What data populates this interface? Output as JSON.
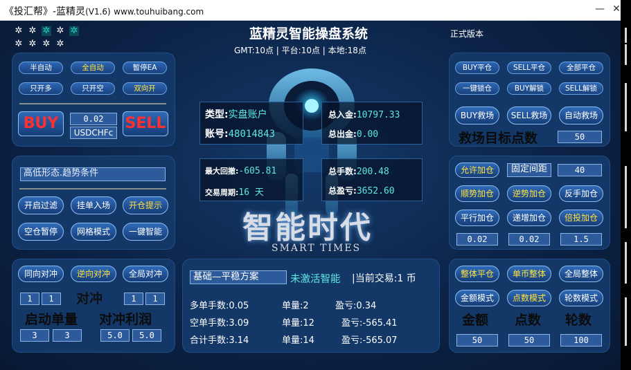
{
  "window": {
    "title": "《投汇帮》-蓝精灵",
    "version": "(V1.6)",
    "url": "www.touhuibang.com",
    "minimize": "—",
    "close": "✕"
  },
  "header": {
    "title": "蓝精灵智能操盘系统",
    "times": "GMT:10点 | 平台:10点 | 本地:18点",
    "edition": "正式版本"
  },
  "stars": [
    "✲",
    "✲",
    "✲",
    "✲",
    "✲",
    "✲",
    "✲",
    "✲",
    "✲"
  ],
  "left_top": {
    "row1": [
      "半自动",
      "全自动",
      "暂停EA"
    ],
    "row2": [
      "只开多",
      "只开空",
      "双向开"
    ],
    "buy": "BUY",
    "sell": "SELL",
    "lot": "0.02",
    "symbol": "USDCHFc"
  },
  "left_mid": {
    "trend": "高低形态.趋势条件",
    "row1": [
      "开启过滤",
      "挂单入场",
      "开仓提示"
    ],
    "row2": [
      "空仓暂停",
      "网格模式",
      "一键智能"
    ]
  },
  "left_bot": {
    "row1": [
      "同向对冲",
      "逆向对冲",
      "全局对冲"
    ],
    "hedge_label": "对冲",
    "f_left": [
      "1",
      "1"
    ],
    "f_right": [
      "1",
      "1"
    ],
    "start_lot_label": "启动单量",
    "hedge_profit_label": "对冲利润",
    "start_lots": [
      "3",
      "3"
    ],
    "hedge_profits": [
      "5.0",
      "5.0"
    ]
  },
  "center": {
    "type_label": "类型:",
    "type_value": "实盘账户",
    "account_label": "账号:",
    "account_value": "48014843",
    "deposit_label": "总入金:",
    "deposit_value": "10797.33",
    "withdraw_label": "总出金:",
    "withdraw_value": "0.00",
    "drawdown_label": "最大回撤:",
    "drawdown_value": "-605.81",
    "period_label": "交易周期:",
    "period_value": "16 天",
    "lots_label": "总手数:",
    "lots_value": "200.48",
    "profit_label": "总盈亏:",
    "profit_value": "3652.60",
    "logo_main": "智能时代",
    "logo_sub": "SMART TIMES"
  },
  "center_bot": {
    "plan": "基础—平稳方案",
    "status": "未激活智能",
    "current": "|当前交易:1 币",
    "rows": [
      [
        "多单手数:0.05",
        "单量:2",
        "盈亏:0.34"
      ],
      [
        "空单手数:3.09",
        "单量:12",
        "盈亏:-565.41"
      ],
      [
        "合计手数:3.14",
        "单量:14",
        "盈亏:-565.07"
      ]
    ]
  },
  "right_top": {
    "row1": [
      "BUY平仓",
      "SELL平仓",
      "全部平仓"
    ],
    "row2": [
      "一键锁仓",
      "BUY解锁",
      "SELL解锁"
    ],
    "row3": [
      "BUY救场",
      "SELL救场",
      "自动救场"
    ],
    "rescue_label": "救场目标点数",
    "rescue_value": "50"
  },
  "right_mid": {
    "allow": "允许加仓",
    "fixed_label": "固定间距",
    "fixed_value": "40",
    "row2": [
      "顺势加仓",
      "逆势加仓",
      "反手加仓"
    ],
    "row3": [
      "平行加仓",
      "递增加仓",
      "倍投加仓"
    ],
    "values": [
      "0.02",
      "0.02",
      "1.5"
    ]
  },
  "right_bot": {
    "row1": [
      "整体平仓",
      "单币整体",
      "全局整体"
    ],
    "row2": [
      "金额模式",
      "点数模式",
      "轮数模式"
    ],
    "labels": [
      "金额",
      "点数",
      "轮数"
    ],
    "values": [
      "50",
      "50",
      "100"
    ]
  }
}
